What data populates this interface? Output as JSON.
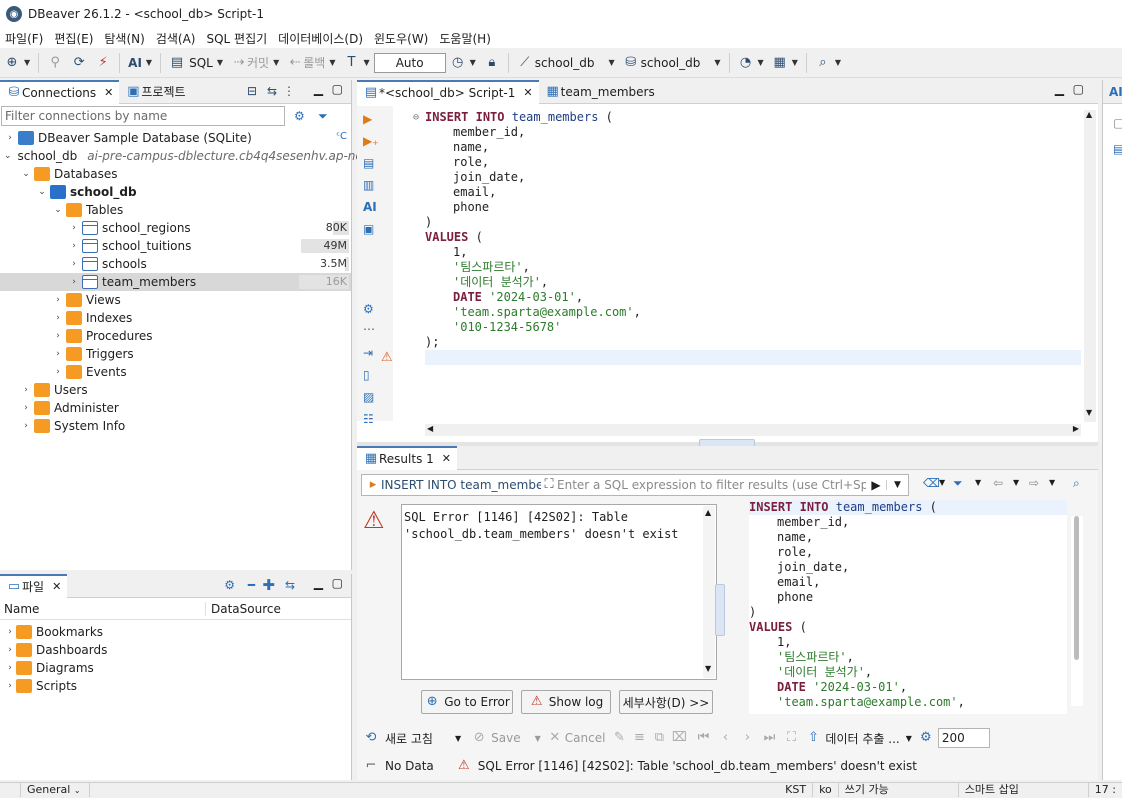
{
  "window": {
    "title": "DBeaver 26.1.2 - <school_db> Script-1"
  },
  "menu": [
    "파일(F)",
    "편집(E)",
    "탐색(N)",
    "검색(A)",
    "SQL 편집기",
    "데이터베이스(D)",
    "윈도우(W)",
    "도움말(H)"
  ],
  "toolbar": {
    "ai_label": "AI",
    "sql_label": "SQL",
    "commit_label": "커밋",
    "rollback_label": "롤백",
    "transaction_mode": "Auto",
    "datasource_label": "school_db",
    "schema_label": "school_db"
  },
  "navigator": {
    "tabs": {
      "connections": "Connections",
      "projects": "프로젝트"
    },
    "filter_placeholder": "Filter connections by name",
    "tree": {
      "sample_db": "DBeaver Sample Database (SQLite)",
      "sample_db_badge": "ᶜC",
      "school_conn": "school_db",
      "school_conn_host": "ai-pre-campus-dblecture.cb4q4sesenhv.ap-no",
      "databases": "Databases",
      "school_db": "school_db",
      "tables": "Tables",
      "table_list": [
        {
          "name": "school_regions",
          "size": "80K",
          "fill": 0.32
        },
        {
          "name": "school_tuitions",
          "size": "49M",
          "fill": 0.96
        },
        {
          "name": "schools",
          "size": "3.5M",
          "fill": 0.08
        },
        {
          "name": "team_members",
          "size": "16K",
          "fill": 1.0
        }
      ],
      "views": "Views",
      "indexes": "Indexes",
      "procedures": "Procedures",
      "triggers": "Triggers",
      "events": "Events",
      "users": "Users",
      "administer": "Administer",
      "system_info": "System Info"
    }
  },
  "files_panel": {
    "tab": "파일",
    "columns": {
      "name": "Name",
      "datasource": "DataSource"
    },
    "items": [
      "Bookmarks",
      "Dashboards",
      "Diagrams",
      "Scripts"
    ]
  },
  "editor": {
    "tabs": {
      "script": "*<school_db> Script-1",
      "table": "team_members"
    },
    "code": {
      "l1_kw1": "INSERT",
      "l1_kw2": "INTO",
      "l1_table": "team_members",
      "l1_paren": "(",
      "cols": [
        "member_id,",
        "name,",
        "role,",
        "join_date,",
        "email,",
        "phone"
      ],
      "close_paren": ")",
      "values_kw": "VALUES",
      "open_paren": "(",
      "v1": "1,",
      "v2": "'팀스파르타'",
      "comma": ",",
      "v3": "'데이터 분석가'",
      "date_kw": "DATE",
      "v4": "'2024-03-01'",
      "v5": "'team.sparta@example.com'",
      "v6": "'010-1234-5678'",
      "end": ");"
    }
  },
  "results": {
    "tab": "Results 1",
    "query_label": "INSERT INTO team_members (",
    "filter_placeholder": "Enter a SQL expression to filter results (use Ctrl+Space)",
    "error_message": "SQL Error [1146] [42S02]: Table 'school_db.team_members' doesn't exist",
    "buttons": {
      "go_to_error": "Go to Error",
      "show_log": "Show log",
      "details": "세부사항(D) >>"
    },
    "bottom": {
      "refresh": "새로 고침",
      "save": "Save",
      "cancel": "Cancel",
      "export": "데이터 추출 ...",
      "fetch_size": "200"
    },
    "status": {
      "no_data": "No Data",
      "error": "SQL Error [1146] [42S02]: Table 'school_db.team_members' doesn't exist"
    }
  },
  "right_strip": {
    "ai_tab": "AI"
  },
  "statusbar": {
    "general": "General",
    "tz": "KST",
    "lang": "ko",
    "mode": "쓰기 가능",
    "insert": "스마트 삽입",
    "pos": "17 : "
  }
}
